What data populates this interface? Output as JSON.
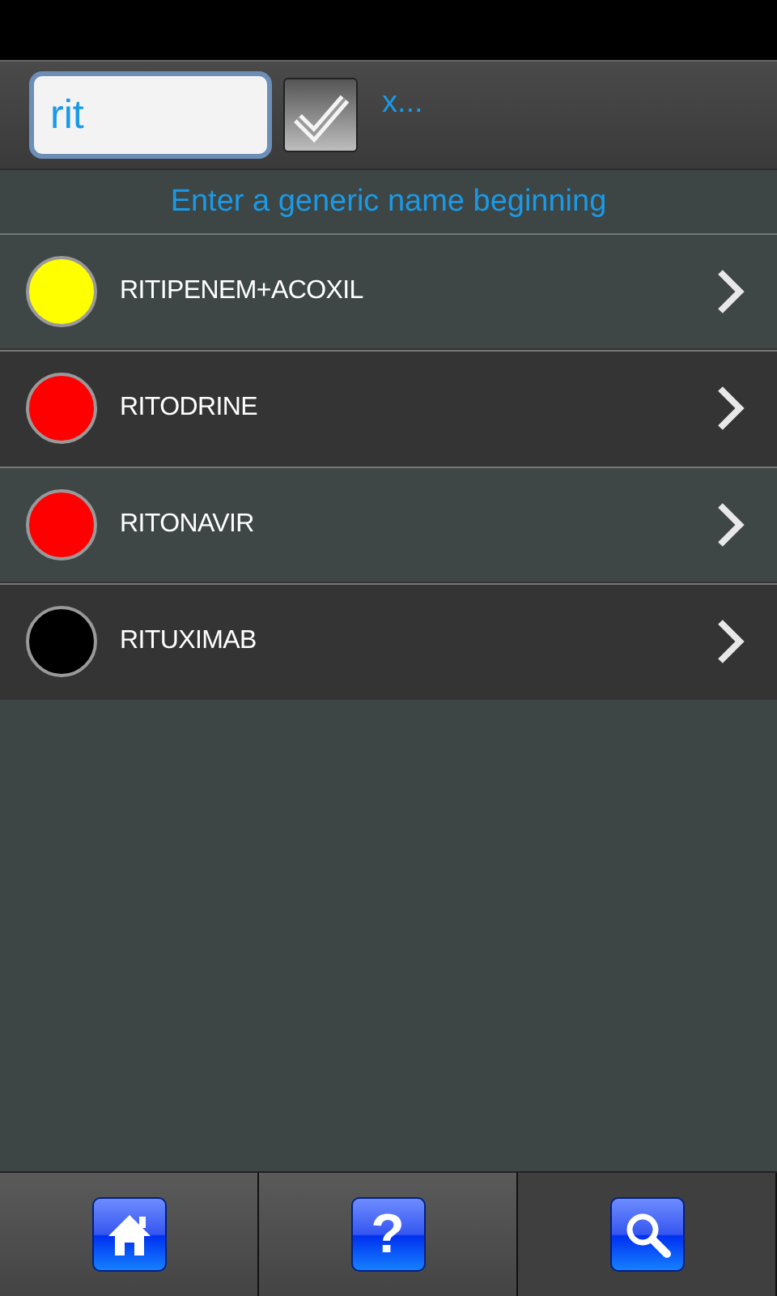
{
  "search": {
    "value": "rit",
    "checked": true,
    "clear_label": "x..."
  },
  "hint": "Enter a generic name beginning",
  "results": [
    {
      "name": "RITIPENEM+ACOXIL",
      "color": "#ffff00"
    },
    {
      "name": "RITODRINE",
      "color": "#ff0000"
    },
    {
      "name": "RITONAVIR",
      "color": "#ff0000"
    },
    {
      "name": "RITUXIMAB",
      "color": "#000000"
    }
  ],
  "tabs": [
    {
      "kind": "home",
      "selected": false
    },
    {
      "kind": "help",
      "glyph": "?",
      "selected": false
    },
    {
      "kind": "search",
      "selected": true
    }
  ]
}
